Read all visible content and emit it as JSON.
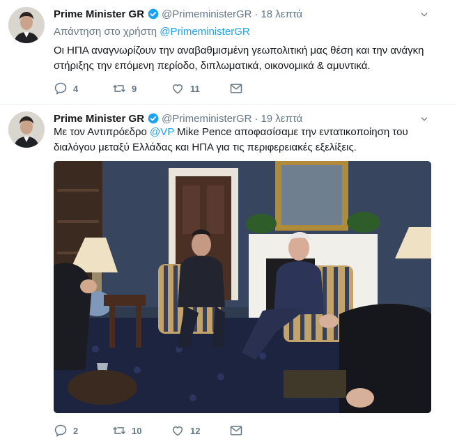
{
  "tweets": [
    {
      "name": "Prime Minister GR",
      "handle": "@PrimeministerGR",
      "separator": "·",
      "time": "18 λεπτά",
      "reply_prefix": "Απάντηση στο χρήστη",
      "reply_mention": "@PrimeministerGR",
      "text": "Οι ΗΠΑ αναγνωρίζουν την αναβαθμισμένη γεωπολιτική μας θέση και την ανάγκη στήριξης την επόμενη περίοδο, διπλωματικά, οικονομικά & αμυντικά.",
      "replies": "4",
      "retweets": "9",
      "likes": "11"
    },
    {
      "name": "Prime Minister GR",
      "handle": "@PrimeministerGR",
      "separator": "·",
      "time": "19 λεπτά",
      "text_before": "Με τον Αντιπρόεδρο ",
      "text_mention": "@VP",
      "text_after": " Mike Pence αποφασίσαμε την εντατικοποίηση του διαλόγου μεταξύ Ελλάδας και ΗΠΑ για τις περιφερειακές εξελίξεις.",
      "replies": "2",
      "retweets": "10",
      "likes": "12"
    }
  ],
  "icons": {
    "verified": "verified-badge-icon",
    "caret": "chevron-down-icon",
    "reply": "reply-icon",
    "retweet": "retweet-icon",
    "like": "heart-icon",
    "dm": "envelope-icon"
  },
  "colors": {
    "accent": "#1da1f2",
    "muted": "#657786",
    "text": "#14171a"
  }
}
